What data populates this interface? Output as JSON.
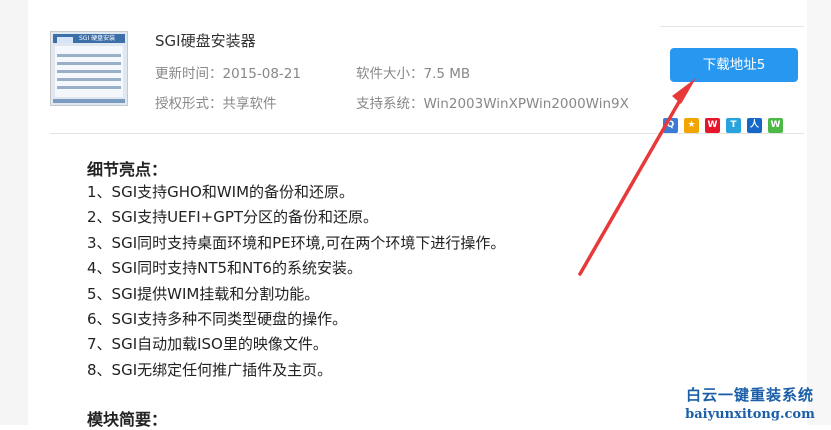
{
  "software": {
    "title": "SGI硬盘安装器",
    "update_time": "更新时间：2015-08-21",
    "size": "软件大小：7.5 MB",
    "license": "授权形式：共享软件",
    "system": "支持系统：Win2003WinXPWin2000Win9X",
    "thumbnail_caption": "SGI 硬盘安装"
  },
  "download_button": "下载地址5",
  "share_icons": [
    {
      "name": "qzone",
      "color": "#3b7bd6",
      "glyph": "Q"
    },
    {
      "name": "favorite-star",
      "color": "#f0a500",
      "glyph": "★"
    },
    {
      "name": "weibo",
      "color": "#e6162d",
      "glyph": "W"
    },
    {
      "name": "tencent-weibo",
      "color": "#29a3de",
      "glyph": "T"
    },
    {
      "name": "renren",
      "color": "#1668c7",
      "glyph": "人"
    },
    {
      "name": "wechat",
      "color": "#4cb946",
      "glyph": "W"
    }
  ],
  "details": {
    "heading": "细节亮点：",
    "items": [
      "1、SGI支持GHO和WIM的备份和还原。",
      "2、SGI支持UEFI+GPT分区的备份和还原。",
      "3、SGI同时支持桌面环境和PE环境,可在两个环境下进行操作。",
      "4、SGI同时支持NT5和NT6的系统安装。",
      "5、SGI提供WIM挂载和分割功能。",
      "6、SGI支持多种不同类型硬盘的操作。",
      "7、SGI自动加载ISO里的映像文件。",
      "8、SGI无绑定任何推广插件及主页。"
    ]
  },
  "modules": {
    "heading": "模块简要："
  },
  "annotation_arrow_color": "#e8393a",
  "watermark": {
    "title": "白云一键重装系统",
    "url": "baiyunxitong.com"
  }
}
